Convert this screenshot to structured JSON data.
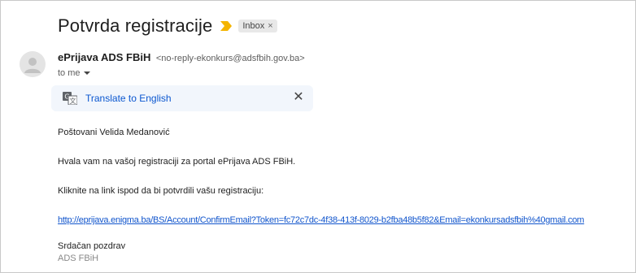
{
  "email": {
    "subject": "Potvrda registracije",
    "label": "Inbox",
    "sender_name": "ePrijava ADS FBiH",
    "sender_email": "<no-reply-ekonkurs@adsfbih.gov.ba>",
    "recipient": "to me",
    "translate_label": "Translate to English",
    "greeting": "Poštovani Velida Medanović",
    "line1": "Hvala vam na vašoj registraciji za portal ePrijava ADS FBiH.",
    "line2": "Kliknite na link ispod da bi potvrdili vašu registraciju:",
    "confirm_link": "http://eprijava.enigma.ba/BS/Account/ConfirmEmail?Token=fc72c7dc-4f38-413f-8029-b2fba48b5f82&Email=ekonkursadsfbih%40gmail.com",
    "closing": "Srdačan pozdrav",
    "signature": "ADS FBiH"
  },
  "icons": {
    "importance": "importance-marker-icon",
    "avatar": "default-avatar-icon",
    "translate": "translate-icon",
    "close": "close-icon"
  },
  "colors": {
    "importance": "#f4b400",
    "link": "#1155cc",
    "translate_bar": "#f2f6fc"
  }
}
